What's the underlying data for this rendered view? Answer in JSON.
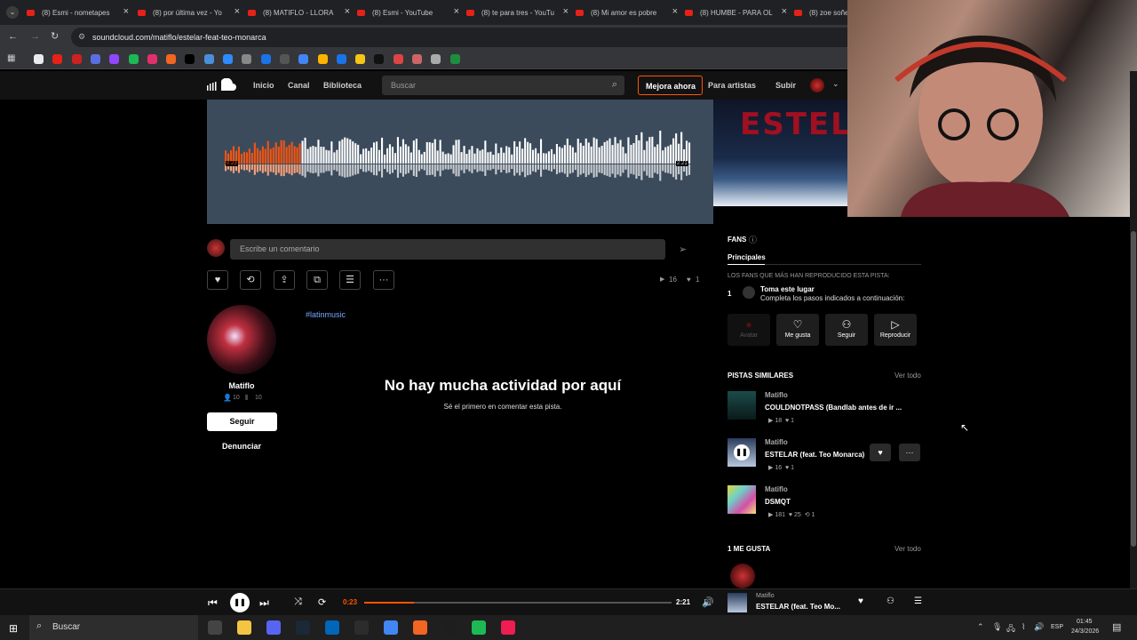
{
  "browser": {
    "tabs": [
      {
        "title": "(8) Esmi - nometapes"
      },
      {
        "title": "(8) por última vez - Yo"
      },
      {
        "title": "(8) MATIFLO - LLORA"
      },
      {
        "title": "(8) Esmi - YouTube"
      },
      {
        "title": "(8) te para tres - YouTu"
      },
      {
        "title": "(8) Mi amor es pobre"
      },
      {
        "title": "(8) HUMBE - PARA OL"
      },
      {
        "title": "(8) zoe soñe"
      }
    ],
    "url": "soundcloud.com/matiflo/estelar-feat-teo-monarca"
  },
  "header": {
    "nav": [
      "Inicio",
      "Canal",
      "Biblioteca"
    ],
    "search_placeholder": "Buscar",
    "upgrade": "Mejora ahora",
    "artists": "Para artistas",
    "upload": "Subir"
  },
  "hero": {
    "time_current": "0:23",
    "time_total": "2:21",
    "progress": 0.163,
    "cover_text": "ESTELA"
  },
  "comment": {
    "placeholder": "Escribe un comentario",
    "plays": "16",
    "likes": "1"
  },
  "artist": {
    "name": "Matiflo",
    "followers": "10",
    "tracks": "10",
    "follow": "Seguir",
    "report": "Denunciar"
  },
  "tag": "#latinmusic",
  "empty": {
    "title": "No hay mucha actividad por aquí",
    "subtitle": "Sé el primero en comentar esta pista."
  },
  "fans": {
    "header": "FANS",
    "tab": "Principales",
    "desc": "LOS FANS QUE MÁS HAN REPRODUCIDO ESTA PISTA:",
    "rank": "1",
    "slot_title": "Toma este lugar",
    "slot_desc": "Completa los pasos indicados a continuación:",
    "buttons": [
      "Avatar",
      "Me gusta",
      "Seguir",
      "Reproducir"
    ]
  },
  "similar": {
    "header": "PISTAS SIMILARES",
    "see_all": "Ver todo",
    "tracks": [
      {
        "artist": "Matiflo",
        "title": "COULDNOTPASS (Bandlab antes de ir ...",
        "plays": "18",
        "likes": "1",
        "reposts": ""
      },
      {
        "artist": "Matiflo",
        "title": "ESTELAR (feat. Teo Monarca)",
        "plays": "16",
        "likes": "1",
        "reposts": ""
      },
      {
        "artist": "Matiflo",
        "title": "DSMQT",
        "plays": "181",
        "likes": "25",
        "reposts": "1"
      }
    ]
  },
  "likes_section": {
    "header": "1 ME GUSTA",
    "see_all": "Ver todo"
  },
  "player": {
    "current": "0:23",
    "total": "2:21",
    "progress": 0.163,
    "artist": "Matiflo",
    "title": "ESTELAR (feat. Teo Mo..."
  },
  "taskbar": {
    "search": "Buscar",
    "lang": "ESP",
    "time": "01:45",
    "date": "24/3/2026"
  },
  "colors": {
    "accent": "#ff5500",
    "bg": "#000000",
    "panel": "#121212"
  }
}
